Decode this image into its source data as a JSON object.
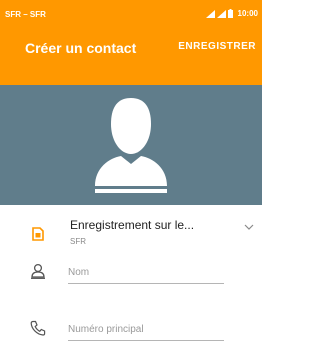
{
  "status_bar": {
    "carrier": "SFR – SFR",
    "time": "10:00"
  },
  "app_bar": {
    "title": "Créer un contact",
    "save_label": "ENREGISTRER",
    "color": "#ff9800"
  },
  "photo": {
    "background": "#607d8b",
    "icon": "person-avatar-icon"
  },
  "storage": {
    "label": "Enregistrement sur le...",
    "account": "SFR",
    "icon": "sim-card-icon"
  },
  "fields": [
    {
      "placeholder": "Nom",
      "value": "",
      "icon": "person-icon"
    },
    {
      "placeholder": "Numéro principal",
      "value": "",
      "icon": "phone-icon"
    }
  ]
}
